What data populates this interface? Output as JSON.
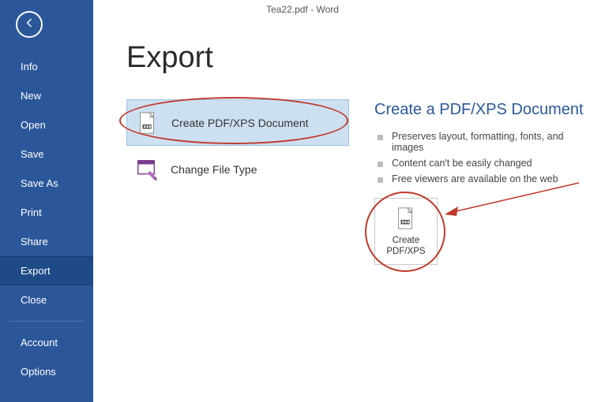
{
  "titlebar": {
    "text": "Tea22.pdf - Word"
  },
  "sidebar": {
    "items": [
      {
        "label": "Info"
      },
      {
        "label": "New"
      },
      {
        "label": "Open"
      },
      {
        "label": "Save"
      },
      {
        "label": "Save As"
      },
      {
        "label": "Print"
      },
      {
        "label": "Share"
      },
      {
        "label": "Export"
      },
      {
        "label": "Close"
      }
    ],
    "footer": [
      {
        "label": "Account"
      },
      {
        "label": "Options"
      }
    ],
    "selected_index": 7
  },
  "page": {
    "title": "Export"
  },
  "options": [
    {
      "label": "Create PDF/XPS Document",
      "selected": true
    },
    {
      "label": "Change File Type",
      "selected": false
    }
  ],
  "panel": {
    "title": "Create a PDF/XPS Document",
    "bullets": [
      "Preserves layout, formatting, fonts, and images",
      "Content can't be easily changed",
      "Free viewers are available on the web"
    ],
    "button": {
      "line1": "Create",
      "line2": "PDF/XPS"
    }
  },
  "colors": {
    "accent": "#2b579a",
    "highlight": "#c0392b",
    "selection": "#cde0f1"
  }
}
